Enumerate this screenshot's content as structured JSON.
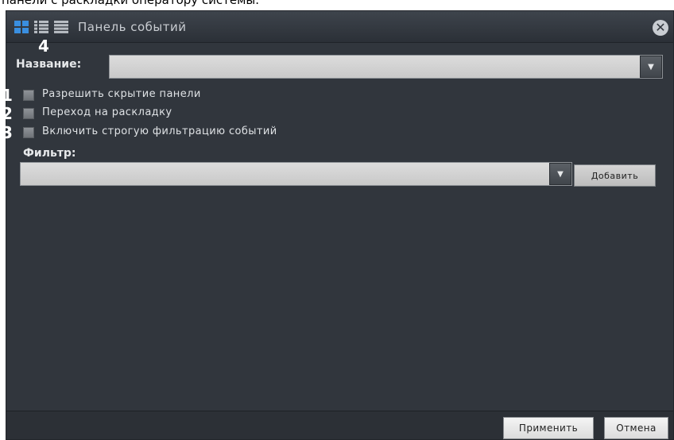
{
  "caption": "панели с раскладки оператору системы.",
  "window": {
    "title": "Панель событий",
    "close_symbol": "✕"
  },
  "toolbar": {
    "icons": [
      "grid-view-icon",
      "detail-list-view-icon",
      "list-view-icon"
    ]
  },
  "markers": {
    "m1": "1",
    "m2": "2",
    "m3": "3",
    "m4": "4"
  },
  "name_field": {
    "label": "Название:",
    "value": "",
    "dropdown_symbol": "▼"
  },
  "options": [
    {
      "label": "Разрешить скрытие панели",
      "checked": false
    },
    {
      "label": "Переход на раскладку",
      "checked": false
    },
    {
      "label": "Включить строгую фильтрацию событий",
      "checked": false
    }
  ],
  "filter": {
    "label": "Фильтр:",
    "value": "",
    "dropdown_symbol": "▼",
    "add_label": "Добавить"
  },
  "footer": {
    "apply_label": "Применить",
    "cancel_label": "Отмена"
  },
  "colors": {
    "accent": "#3a8fe0",
    "panel_bg": "#31363d"
  }
}
